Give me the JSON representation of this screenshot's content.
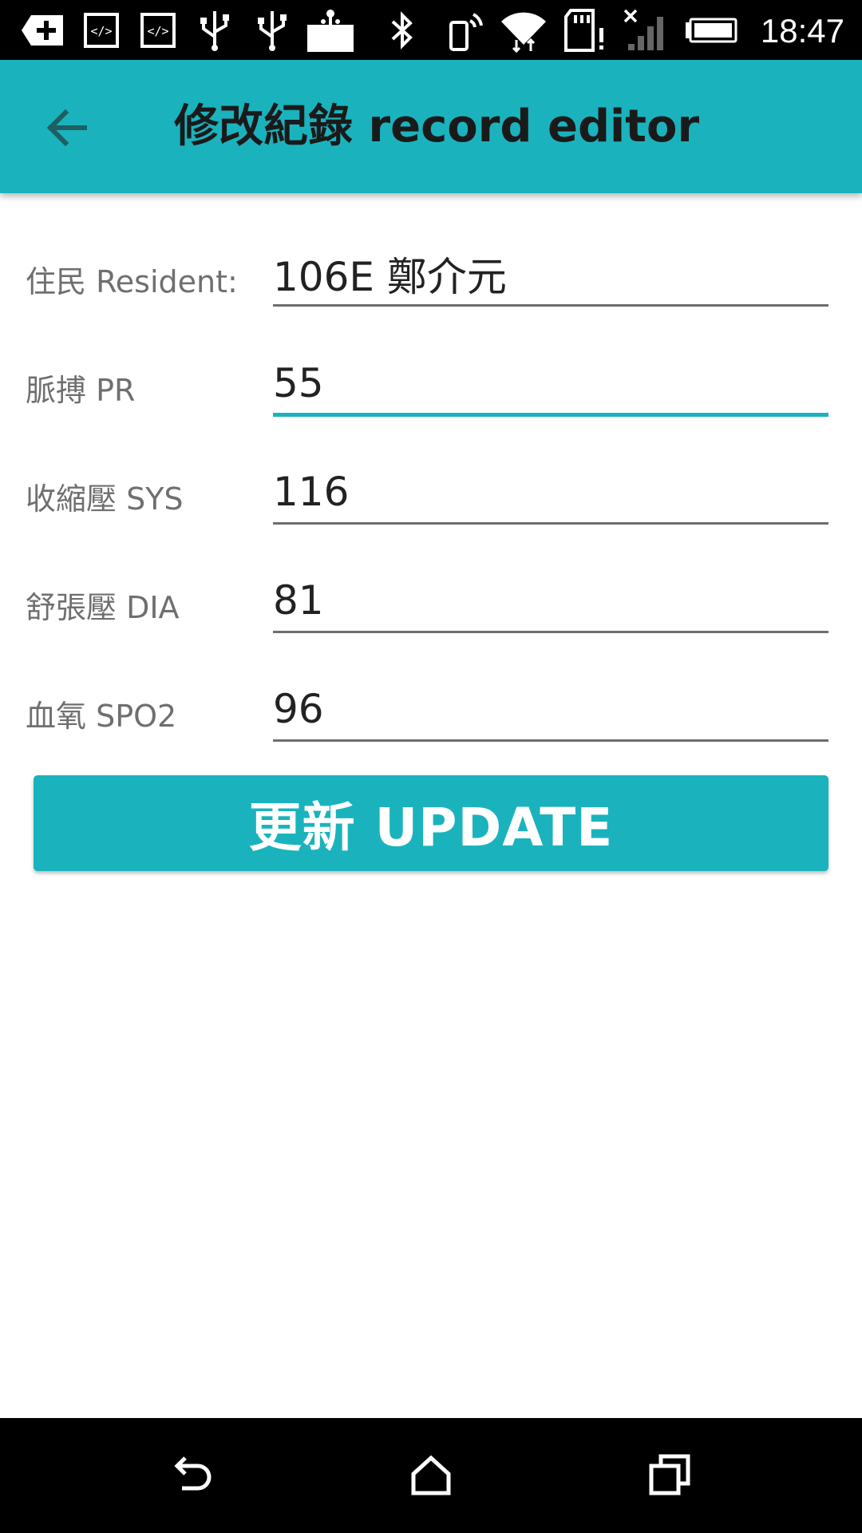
{
  "status_bar": {
    "time": "18:47",
    "icons": [
      "add-box-icon",
      "code-icon",
      "code-icon",
      "usb-icon",
      "usb-icon",
      "basket-icon",
      "bluetooth-icon",
      "phone-signal-icon",
      "wifi-icon",
      "sd-card-alert-icon",
      "no-signal-icon",
      "battery-icon"
    ]
  },
  "app_bar": {
    "title": "修改紀錄 record editor",
    "back_icon": "back-arrow-icon"
  },
  "form": {
    "rows": [
      {
        "label": "住民 Resident:",
        "value": "106E 鄭介元",
        "focused": false
      },
      {
        "label": "脈搏 PR",
        "value": "55",
        "focused": true
      },
      {
        "label": "收縮壓 SYS",
        "value": "116",
        "focused": false
      },
      {
        "label": "舒張壓 DIA",
        "value": "81",
        "focused": false
      },
      {
        "label": "血氧 SPO2",
        "value": "96",
        "focused": false
      }
    ]
  },
  "update_button": {
    "label": "更新 UPDATE"
  },
  "nav_bar": {
    "icons": [
      "nav-back-icon",
      "nav-home-icon",
      "nav-recents-icon"
    ]
  },
  "colors": {
    "accent": "#1ab3bd",
    "status_bar": "#000000",
    "nav_bar": "#000000"
  }
}
